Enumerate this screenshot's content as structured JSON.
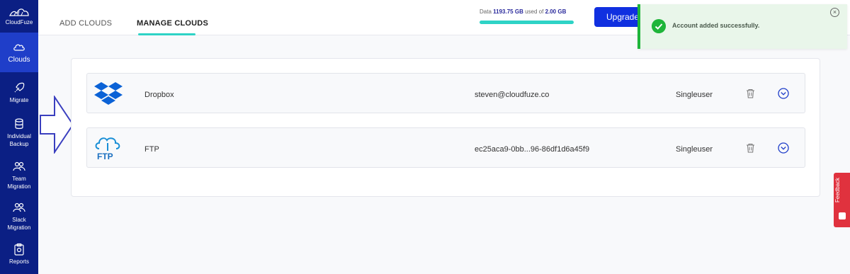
{
  "app": {
    "name": "CloudFuze"
  },
  "sidebar": {
    "items": [
      {
        "label": "Clouds",
        "icon": "cloud-icon",
        "active": true
      },
      {
        "label": "Migrate",
        "icon": "rocket-icon"
      },
      {
        "label": "Individual\nBackup",
        "icon": "database-icon"
      },
      {
        "label": "Team\nMigration",
        "icon": "users-icon"
      },
      {
        "label": "Slack\nMigration",
        "icon": "users-icon"
      },
      {
        "label": "Reports",
        "icon": "clipboard-icon"
      }
    ]
  },
  "tabs": [
    {
      "label": "ADD CLOUDS",
      "active": false
    },
    {
      "label": "MANAGE CLOUDS",
      "active": true
    }
  ],
  "storage": {
    "prefix": "Data",
    "used": "1193.75 GB",
    "middle": "used of",
    "total": "2.00 GB"
  },
  "upgrade_label": "Upgrade",
  "toast": {
    "message": "Account added successfully.",
    "close": "×"
  },
  "clouds": [
    {
      "name": "Dropbox",
      "icon": "dropbox-icon",
      "account": "steven@cloudfuze.co",
      "type": "Singleuser"
    },
    {
      "name": "FTP",
      "icon": "ftp-cloud-icon",
      "account": "ec25aca9-0bb...96-86df1d6a45f9",
      "type": "Singleuser"
    }
  ],
  "feedback_label": "Feedback",
  "colors": {
    "sidebar": "#0b1f84",
    "accent": "#2ed3c6",
    "primary": "#1030e0",
    "success": "#1fb53a",
    "feedback": "#e0323e"
  }
}
